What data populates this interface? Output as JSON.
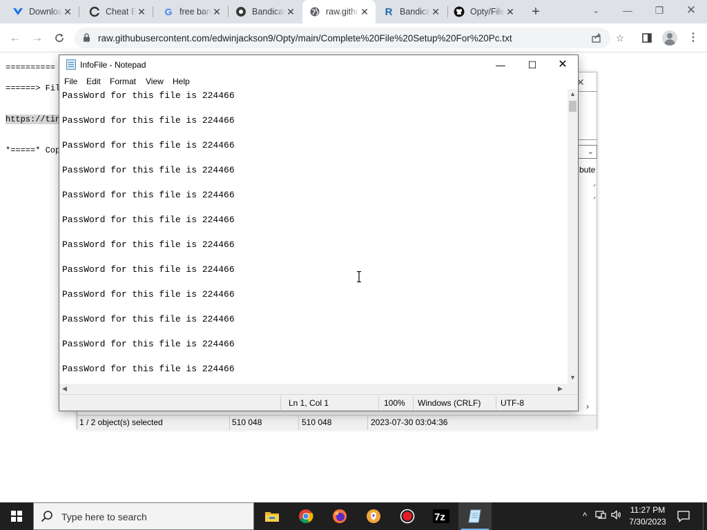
{
  "browser": {
    "tabs": [
      {
        "label": "Download",
        "icon": "tabler-logo-icon",
        "color": "#1a73e8"
      },
      {
        "label": "Cheat Engine",
        "icon": "cheat-engine-icon",
        "color": "#444"
      },
      {
        "label": "free bandicam",
        "icon": "google-icon",
        "color": "#4285f4"
      },
      {
        "label": "Bandicam",
        "icon": "bandicam-icon",
        "color": "#333"
      },
      {
        "label": "raw.githubusercontent.com",
        "icon": "globe-icon",
        "color": "#5f6368"
      },
      {
        "label": "Bandicam",
        "icon": "r-logo-icon",
        "color": "#2167b1"
      },
      {
        "label": "Opty/File",
        "icon": "github-icon",
        "color": "#111"
      }
    ],
    "new_tab": "+",
    "url": "raw.githubusercontent.com/edwinjackson9/Opty/main/Complete%20File%20Setup%20For%20Pc.txt"
  },
  "page": {
    "lines": [
      "==========",
      "======> Fil",
      "https://tin",
      "*=====* Cop"
    ]
  },
  "zip": {
    "status": {
      "selected": "1 / 2 object(s) selected",
      "size": "510 048",
      "packed": "510 048",
      "modified": "2023-07-30 03:04:36"
    },
    "column_fragment": "bute"
  },
  "notepad": {
    "title": "InfoFile - Notepad",
    "menu": [
      "File",
      "Edit",
      "Format",
      "View",
      "Help"
    ],
    "lines": [
      "PassWord for this file is 224466",
      "PassWord for this file is 224466",
      "PassWord for this file is 224466",
      "PassWord for this file is 224466",
      "PassWord for this file is 224466",
      "PassWord for this file is 224466",
      "PassWord for this file is 224466",
      "PassWord for this file is 224466",
      "PassWord for this file is 224466",
      "PassWord for this file is 224466",
      "PassWord for this file is 224466",
      "PassWord for this file is 224466"
    ],
    "status": {
      "position": "Ln 1, Col 1",
      "zoom": "100%",
      "line_ending": "Windows (CRLF)",
      "encoding": "UTF-8"
    }
  },
  "taskbar": {
    "search_placeholder": "Type here to search",
    "apps": [
      "file-explorer-icon",
      "chrome-icon",
      "firefox-icon",
      "brave-icon",
      "record-icon",
      "7zip-icon",
      "notepad-icon"
    ],
    "time": "11:27 PM",
    "date": "7/30/2023"
  }
}
